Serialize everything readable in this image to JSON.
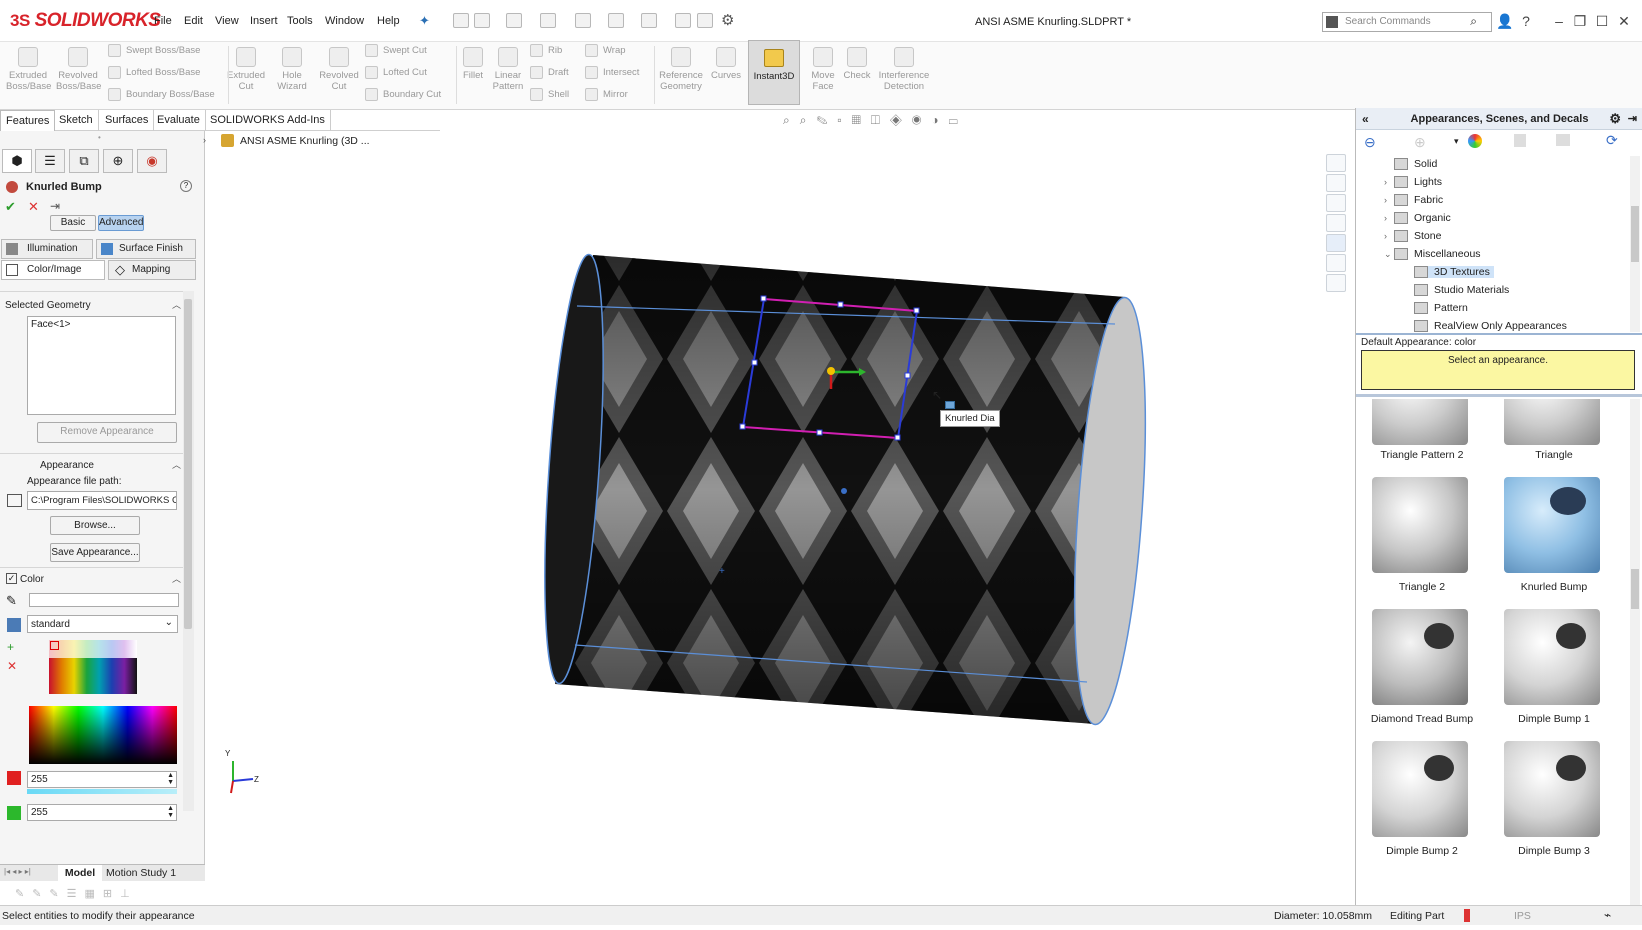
{
  "app": {
    "logo": "SOLIDWORKS",
    "doc_title": "ANSI ASME Knurling.SLDPRT *"
  },
  "menu": [
    "File",
    "Edit",
    "View",
    "Insert",
    "Tools",
    "Window",
    "Help"
  ],
  "search": {
    "placeholder": "Search Commands"
  },
  "ribbon": {
    "extruded_boss": "Extruded Boss/Base",
    "revolved_boss": "Revolved Boss/Base",
    "swept_boss": "Swept Boss/Base",
    "lofted_boss": "Lofted Boss/Base",
    "boundary_boss": "Boundary Boss/Base",
    "extruded_cut": "Extruded Cut",
    "hole_wizard": "Hole Wizard",
    "revolved_cut": "Revolved Cut",
    "swept_cut": "Swept Cut",
    "lofted_cut": "Lofted Cut",
    "boundary_cut": "Boundary Cut",
    "fillet": "Fillet",
    "linear_pattern": "Linear Pattern",
    "rib": "Rib",
    "draft": "Draft",
    "shell": "Shell",
    "wrap": "Wrap",
    "intersect": "Intersect",
    "mirror": "Mirror",
    "reference_geometry": "Reference Geometry",
    "curves": "Curves",
    "instant3d": "Instant3D",
    "move_face": "Move Face",
    "check": "Check",
    "interference": "Interference Detection"
  },
  "cm_tabs": [
    "Features",
    "Sketch",
    "Surfaces",
    "Evaluate",
    "SOLIDWORKS Add-Ins"
  ],
  "feature_tree_root": "ANSI ASME Knurling  (3D ...",
  "property_manager": {
    "title": "Knurled Bump",
    "basic": "Basic",
    "advanced": "Advanced",
    "tabs": {
      "illumination": "Illumination",
      "surface_finish": "Surface Finish",
      "color_image": "Color/Image",
      "mapping": "Mapping"
    },
    "selected_geometry": "Selected Geometry",
    "selection": "Face<1>",
    "remove": "Remove Appearance",
    "appearance": "Appearance",
    "path_label": "Appearance file path:",
    "path_value": "C:\\Program Files\\SOLIDWORKS Co",
    "browse": "Browse...",
    "save": "Save Appearance...",
    "color": "Color",
    "palette": "standard",
    "r_value": "255",
    "g_value": "255"
  },
  "bottom_tabs": [
    "Model",
    "Motion Study 1"
  ],
  "viewport": {
    "tooltip": "Knurled Dia",
    "axes": {
      "y": "Y",
      "z": "Z"
    }
  },
  "taskpane": {
    "title": "Appearances, Scenes, and Decals",
    "tree": [
      {
        "label": "Solid",
        "indent": 0,
        "exp": ""
      },
      {
        "label": "Lights",
        "indent": 0,
        "exp": "›"
      },
      {
        "label": "Fabric",
        "indent": 0,
        "exp": "›"
      },
      {
        "label": "Organic",
        "indent": 0,
        "exp": "›"
      },
      {
        "label": "Stone",
        "indent": 0,
        "exp": "›"
      },
      {
        "label": "Miscellaneous",
        "indent": 0,
        "exp": "⌄"
      },
      {
        "label": "3D Textures",
        "indent": 1,
        "exp": ""
      },
      {
        "label": "Studio Materials",
        "indent": 1,
        "exp": ""
      },
      {
        "label": "Pattern",
        "indent": 1,
        "exp": ""
      },
      {
        "label": "RealView Only Appearances",
        "indent": 1,
        "exp": ""
      }
    ],
    "default_label": "Default Appearance: color",
    "hint": "Select an appearance.",
    "thumbs": [
      "Triangle Pattern 2",
      "Triangle",
      "Triangle 2",
      "Knurled Bump",
      "Diamond Tread Bump",
      "Dimple Bump 1",
      "Dimple Bump 2",
      "Dimple Bump 3"
    ]
  },
  "status": {
    "left": "Select entities to modify their appearance",
    "diameter": "Diameter: 10.058mm",
    "mode": "Editing Part",
    "units": "IPS"
  }
}
